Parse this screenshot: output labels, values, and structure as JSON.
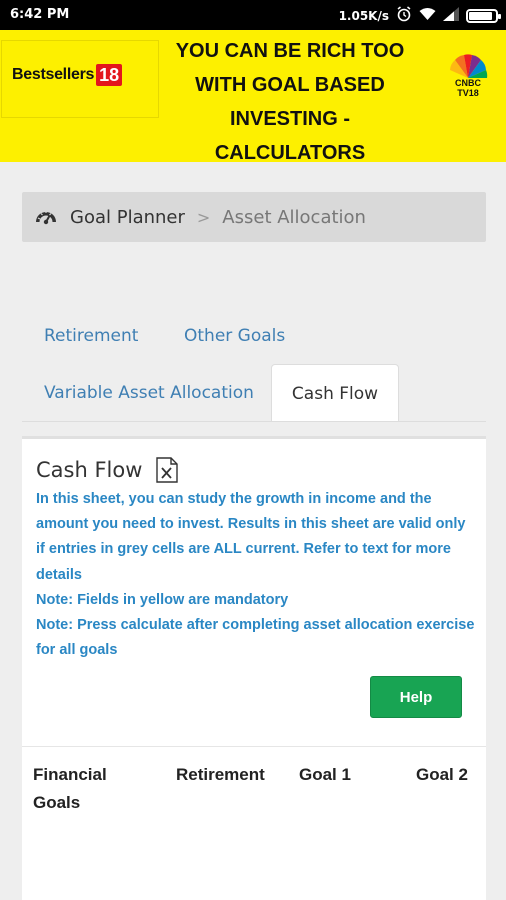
{
  "status_bar": {
    "time": "6:42 PM",
    "network_speed": "1.05K/s",
    "icons": [
      "alarm-icon",
      "wifi-icon",
      "signal-icon",
      "battery-icon"
    ],
    "battery_level": 0.9
  },
  "banner": {
    "brand": "Bestsellers",
    "brand_number": "18",
    "title": "YOU CAN BE RICH TOO WITH GOAL BASED INVESTING - CALCULATORS",
    "channel_line1": "CNBC",
    "channel_line2": "TV18"
  },
  "breadcrumb": {
    "icon": "dashboard-icon",
    "home": "Goal Planner",
    "separator": ">",
    "current": "Asset Allocation"
  },
  "tabs": {
    "retirement": "Retirement",
    "other_goals": "Other Goals",
    "variable_asset_allocation": "Variable Asset Allocation",
    "cash_flow": "Cash Flow"
  },
  "panel": {
    "title": "Cash Flow",
    "title_icon": "excel-icon",
    "description": "In this sheet, you can study the growth in income and the amount you need to invest. Results in this sheet are valid only if entries in grey cells are ALL current. Refer to text for more details",
    "note_yellow": "Note: Fields in yellow are mandatory",
    "note_calculate": "Note: Press calculate after completing asset allocation exercise for all goals",
    "help_label": "Help"
  },
  "table": {
    "headers": [
      "Financial Goals",
      "Retirement",
      "Goal 1",
      "Goal 2"
    ]
  },
  "colors": {
    "banner_yellow": "#fdf000",
    "link_blue": "#3f7fb3",
    "note_blue": "#2a87c4",
    "help_green": "#18a453"
  }
}
